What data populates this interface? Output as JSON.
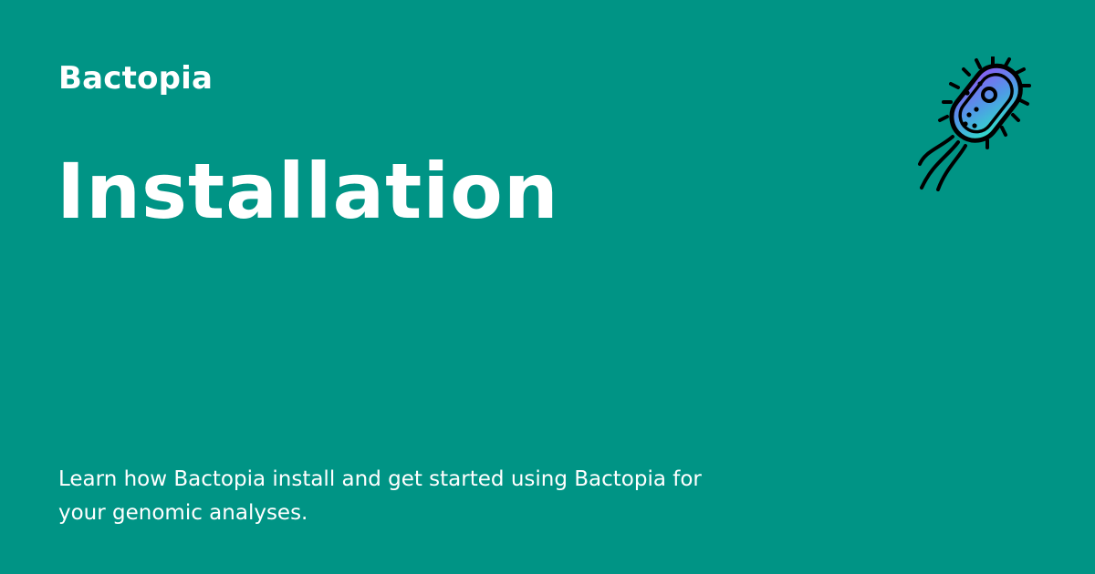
{
  "header": {
    "site_name": "Bactopia",
    "logo_icon": "bacterium-icon"
  },
  "main": {
    "title": "Installation",
    "description": "Learn how Bactopia install and get started using Bactopia for your genomic analyses."
  },
  "colors": {
    "background": "#009485",
    "text": "#ffffff",
    "icon_gradient_top": "#8a5cf5",
    "icon_gradient_bottom": "#2fe0c8",
    "icon_outline": "#000000"
  }
}
